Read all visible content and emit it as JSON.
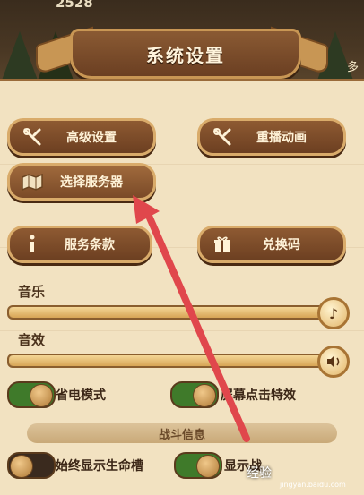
{
  "top_bar": {
    "coins": "2528",
    "side_tag": "多"
  },
  "title": "系统设置",
  "buttons": {
    "advanced": "高级设置",
    "replay": "重播动画",
    "server": "选择服务器",
    "terms": "服务条款",
    "redeem": "兑换码"
  },
  "music": {
    "label": "音乐",
    "level": 1.0
  },
  "sound": {
    "label": "音效",
    "level": 1.0
  },
  "toggles": {
    "power_save": "省电模式",
    "screen_fx": "屏幕点击特效",
    "hp_bar": "始终显示生命槽",
    "show_partial": "显示战"
  },
  "section": "战斗信息",
  "watermark": {
    "brand": "经验",
    "url": "jingyan.baidu.com"
  },
  "colors": {
    "accent": "#e0474c",
    "toggle_on": "#3f7a2a"
  }
}
